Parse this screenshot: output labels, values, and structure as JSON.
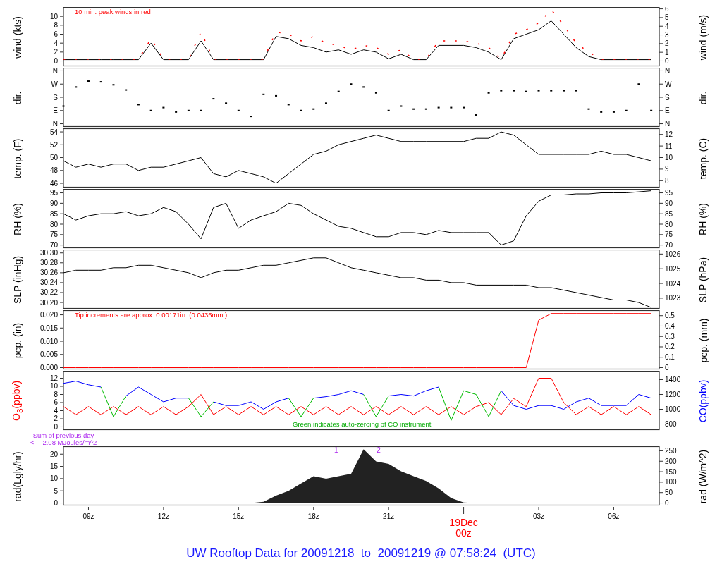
{
  "panels": [
    {
      "left_title": "wind (kts)",
      "right_title": "wind (m/s)",
      "note": "10 min. peak winds in red",
      "chart_data": {
        "type": "line",
        "categories": [
          null,
          null,
          null,
          null,
          null,
          null,
          null,
          null,
          null,
          null,
          null,
          null,
          null,
          null,
          null,
          null,
          null,
          null,
          null,
          null,
          null,
          null,
          null,
          null,
          null,
          null,
          null,
          null,
          null,
          null,
          null,
          null,
          null,
          null,
          null,
          null,
          null,
          null,
          null,
          null,
          null,
          null,
          null,
          null,
          null,
          null,
          null,
          null
        ],
        "ylim": [
          -1.1,
          12
        ],
        "yticks": [
          0,
          2,
          4,
          6,
          8,
          10
        ],
        "y2lim": [
          -0.57,
          6.17
        ],
        "y2ticks": [
          0,
          1,
          2,
          3,
          4,
          5,
          6
        ],
        "series": [
          {
            "color": "#000000",
            "values": [
              0.3,
              0.3,
              0.3,
              0.3,
              0.3,
              0.3,
              0.3,
              4,
              0.3,
              0.3,
              0.3,
              4.5,
              0.3,
              0.3,
              0.3,
              0.3,
              0.3,
              5.5,
              5,
              3.5,
              3,
              2,
              2.5,
              1.5,
              2.5,
              2,
              0.5,
              1.5,
              0.3,
              0.3,
              3.5,
              3.5,
              3.5,
              3,
              2,
              0.3,
              5,
              6,
              7,
              9,
              6,
              3,
              1,
              0.3,
              0.3,
              0.3,
              0.3,
              0.3
            ]
          },
          {
            "color": "#ff0000",
            "line_style": "dashed",
            "values": [
              0.4,
              0.4,
              0.4,
              0.4,
              0.4,
              0.4,
              0.4,
              5,
              0.4,
              0.4,
              0.4,
              6.5,
              0.4,
              0.4,
              0.4,
              0.4,
              0.4,
              6.5,
              6,
              4.5,
              5.5,
              4,
              3.5,
              2.5,
              3.5,
              3,
              1.5,
              2.5,
              0.4,
              0.4,
              4.5,
              4.5,
              4.5,
              4,
              3,
              0.4,
              6,
              7,
              8.5,
              11.5,
              8,
              4,
              2,
              0.4,
              0.4,
              0.4,
              0.4,
              0.4
            ]
          }
        ]
      }
    },
    {
      "left_title": "dir.",
      "right_title": "dir.",
      "direction_scale": {
        "left": [
          "N",
          "W",
          "S",
          "E",
          "N"
        ],
        "right": [
          "N",
          "W",
          "S",
          "E",
          "N"
        ]
      }
    },
    {
      "left_title": "temp. (F)",
      "right_title": "temp. (C)",
      "chart_data": {
        "type": "line",
        "categories": [
          null,
          null,
          null,
          null,
          null,
          null,
          null,
          null,
          null,
          null,
          null,
          null,
          null,
          null,
          null,
          null,
          null,
          null,
          null,
          null,
          null,
          null,
          null,
          null,
          null,
          null,
          null,
          null,
          null,
          null,
          null,
          null,
          null,
          null,
          null,
          null,
          null,
          null,
          null,
          null,
          null,
          null,
          null,
          null,
          null,
          null,
          null,
          null
        ],
        "ylim": [
          45.4,
          54.5
        ],
        "yticks": [
          46,
          48,
          50,
          52,
          54
        ],
        "y2lim": [
          7.44,
          12.5
        ],
        "y2ticks": [
          8,
          9,
          10,
          11,
          12
        ],
        "series": [
          {
            "color": "#000000",
            "values": [
              49.5,
              48.5,
              49,
              48.5,
              49,
              49,
              48,
              48.5,
              48.5,
              49,
              49.5,
              50,
              47.5,
              47,
              48,
              47.5,
              47,
              46,
              47.5,
              49,
              50.5,
              51,
              52,
              52.5,
              53,
              53.5,
              53,
              52.5,
              52.5,
              52.5,
              52.5,
              52.5,
              52.5,
              53,
              53,
              54,
              53.5,
              52,
              50.5,
              50.5,
              50.5,
              50.5,
              50.5,
              51,
              50.5,
              50.5,
              50,
              49.5
            ]
          }
        ]
      }
    },
    {
      "left_title": "RH (%)",
      "right_title": "RH (%)",
      "chart_data": {
        "type": "line",
        "categories": [
          null,
          null,
          null,
          null,
          null,
          null,
          null,
          null,
          null,
          null,
          null,
          null,
          null,
          null,
          null,
          null,
          null,
          null,
          null,
          null,
          null,
          null,
          null,
          null,
          null,
          null,
          null,
          null,
          null,
          null,
          null,
          null,
          null,
          null,
          null,
          null,
          null,
          null,
          null,
          null,
          null,
          null,
          null,
          null,
          null,
          null,
          null,
          null
        ],
        "ylim": [
          68.7,
          96.7
        ],
        "yticks": [
          70,
          75,
          80,
          85,
          90,
          95
        ],
        "y2lim": [
          68.7,
          96.7
        ],
        "y2ticks": [
          70,
          75,
          80,
          85,
          90,
          95
        ],
        "series": [
          {
            "color": "#000000",
            "values": [
              85,
              82,
              84,
              85,
              85,
              86,
              84,
              85,
              88,
              86,
              80,
              73,
              88,
              90,
              78,
              82,
              84,
              86,
              90,
              89,
              85,
              82,
              79,
              78,
              76,
              74,
              74,
              76,
              76,
              75,
              77,
              76,
              76,
              76,
              76,
              70,
              72,
              84,
              91,
              94,
              94,
              94.5,
              94.5,
              95,
              95,
              95,
              95.5,
              96
            ]
          }
        ]
      }
    },
    {
      "left_title": "SLP (inHg)",
      "right_title": "SLP (hPa)",
      "chart_data": {
        "type": "line",
        "categories": [
          null,
          null,
          null,
          null,
          null,
          null,
          null,
          null,
          null,
          null,
          null,
          null,
          null,
          null,
          null,
          null,
          null,
          null,
          null,
          null,
          null,
          null,
          null,
          null,
          null,
          null,
          null,
          null,
          null,
          null,
          null,
          null,
          null,
          null,
          null,
          null,
          null,
          null,
          null,
          null,
          null,
          null,
          null,
          null,
          null,
          null,
          null,
          null
        ],
        "ylim": [
          30.188,
          30.306
        ],
        "yticks": [
          {
            "value": 30.2,
            "label": "30.20"
          },
          {
            "value": 30.22,
            "label": "30.22"
          },
          {
            "value": 30.24,
            "label": "30.24"
          },
          {
            "value": 30.26,
            "label": "30.26"
          },
          {
            "value": 30.28,
            "label": "30.28"
          },
          {
            "value": 30.3,
            "label": "30.30"
          }
        ],
        "y2lim": [
          1022.3,
          1026.28
        ],
        "y2ticks": [
          1023,
          1024,
          1025,
          1026
        ],
        "series": [
          {
            "color": "#000000",
            "values": [
              30.26,
              30.265,
              30.265,
              30.265,
              30.27,
              30.27,
              30.275,
              30.275,
              30.27,
              30.265,
              30.26,
              30.25,
              30.26,
              30.265,
              30.265,
              30.27,
              30.275,
              30.275,
              30.28,
              30.285,
              30.29,
              30.29,
              30.28,
              30.27,
              30.265,
              30.26,
              30.255,
              30.25,
              30.25,
              30.245,
              30.245,
              30.24,
              30.24,
              30.235,
              30.235,
              30.235,
              30.235,
              30.235,
              30.23,
              30.23,
              30.225,
              30.22,
              30.215,
              30.21,
              30.205,
              30.205,
              30.2,
              30.19
            ]
          }
        ]
      }
    },
    {
      "left_title": "pcp. (in)",
      "right_title": "pcp. (mm)",
      "note": "Tip increments are approx. 0.00171in. (0.0435mm.)",
      "chart_data": {
        "type": "line",
        "categories": [
          null,
          null,
          null,
          null,
          null,
          null,
          null,
          null,
          null,
          null,
          null,
          null,
          null,
          null,
          null,
          null,
          null,
          null,
          null,
          null,
          null,
          null,
          null,
          null,
          null,
          null,
          null,
          null,
          null,
          null,
          null,
          null,
          null,
          null,
          null,
          null,
          null,
          null,
          null,
          null,
          null,
          null,
          null,
          null,
          null,
          null,
          null,
          null
        ],
        "ylim": [
          -0.00054,
          0.02162
        ],
        "yticks": [
          {
            "value": 0,
            "label": "0.000"
          },
          {
            "value": 0.005,
            "label": "0.005"
          },
          {
            "value": 0.01,
            "label": "0.010"
          },
          {
            "value": 0.015,
            "label": "0.015"
          },
          {
            "value": 0.02,
            "label": "0.020"
          }
        ],
        "y2lim": [
          -0.0137,
          0.549
        ],
        "y2ticks": [
          0,
          0.1,
          0.2,
          0.3,
          0.4,
          0.5
        ],
        "series": [
          {
            "color": "#ff0000",
            "values": [
              0,
              0,
              0,
              0,
              0,
              0,
              0,
              0,
              0,
              0,
              0,
              0,
              0,
              0,
              0,
              0,
              0,
              0,
              0,
              0,
              0,
              0,
              0,
              0,
              0,
              0,
              0,
              0,
              0,
              0,
              0,
              0,
              0,
              0,
              0,
              0,
              0,
              0,
              0.018,
              0.0205,
              0.0205,
              0.0205,
              0.0205,
              0.0205,
              0.0205,
              0.0205,
              0.0205,
              0.0205
            ]
          }
        ]
      }
    },
    {
      "left_title": "O$_{3}$(ppbv)",
      "right_title": "CO(ppbv)",
      "footnote": "Green indicates auto-zeroing of CO instrument",
      "chart_data": {
        "type": "line",
        "categories": [
          null,
          null,
          null,
          null,
          null,
          null,
          null,
          null,
          null,
          null,
          null,
          null,
          null,
          null,
          null,
          null,
          null,
          null,
          null,
          null,
          null,
          null,
          null,
          null,
          null,
          null,
          null,
          null,
          null,
          null,
          null,
          null,
          null,
          null,
          null,
          null,
          null,
          null,
          null,
          null,
          null,
          null,
          null,
          null,
          null,
          null,
          null,
          null
        ],
        "ylim": [
          -0.7,
          13.74
        ],
        "yticks": [
          0,
          2,
          4,
          6,
          8,
          10,
          12
        ],
        "y2lim": [
          724,
          1514
        ],
        "y2ticks": [
          800,
          1000,
          1200,
          1400
        ],
        "series": [
          {
            "color": "#ff0000",
            "values": [
              5,
              3,
              5,
              3,
              5,
              3,
              5,
              3,
              5,
              3,
              5,
              8,
              3,
              5,
              3,
              5,
              3,
              5,
              3,
              5,
              3,
              5,
              3,
              5,
              3,
              5,
              3,
              5,
              3,
              5,
              3,
              5,
              3,
              5,
              6,
              3,
              7,
              5,
              12,
              12,
              6,
              3,
              5,
              3,
              5,
              3,
              5,
              3
            ]
          },
          {
            "axis": "y2",
            "color": "#0000ff",
            "values": [
              1350,
              1380,
              1330,
              1300,
              null,
              1180,
              1300,
              1200,
              1100,
              1150,
              1150,
              null,
              1100,
              1050,
              1050,
              1100,
              1000,
              1100,
              1150,
              null,
              1150,
              1170,
              1200,
              1250,
              1200,
              null,
              1180,
              1200,
              1180,
              1250,
              1300,
              null,
              null,
              null,
              null,
              1250,
              1050,
              1000,
              1050,
              1050,
              1000,
              1100,
              1150,
              1050,
              1050,
              1050,
              1200,
              1150
            ]
          },
          {
            "axis": "y2",
            "color": "#00bb00",
            "values": [
              null,
              null,
              null,
              1300,
              900,
              1180,
              null,
              null,
              null,
              null,
              1150,
              900,
              1100,
              null,
              null,
              null,
              null,
              null,
              1150,
              900,
              1150,
              null,
              null,
              null,
              1200,
              900,
              1180,
              null,
              null,
              null,
              1300,
              850,
              1250,
              1200,
              900,
              1250,
              null,
              null,
              null,
              null,
              null,
              null,
              null,
              null,
              null,
              null,
              null,
              null
            ]
          }
        ]
      }
    },
    {
      "left_title": "rad(Lgly/hr)",
      "right_title": "rad (W/m^2)",
      "margin_notes": [
        "Sum of previous day",
        "<--- 2.08 MJoules/m^2"
      ],
      "markers": [
        "1",
        "2"
      ],
      "chart_data": {
        "type": "area",
        "categories": [
          null,
          null,
          null,
          null,
          null,
          null,
          null,
          null,
          null,
          null,
          null,
          null,
          null,
          null,
          null,
          null,
          null,
          null,
          null,
          null,
          null,
          null,
          null,
          null,
          null,
          null,
          null,
          null,
          null,
          null,
          null,
          null,
          null,
          null,
          null,
          null,
          null,
          null,
          null,
          null,
          null,
          null,
          null,
          null,
          null,
          null,
          null,
          null
        ],
        "ylim": [
          -0.86,
          23.1
        ],
        "yticks": [
          0,
          5,
          10,
          15,
          20
        ],
        "y2lim": [
          -10,
          270
        ],
        "y2ticks": [
          0,
          50,
          100,
          150,
          200,
          250
        ],
        "series": [
          {
            "color": "#222222",
            "values": [
              0,
              0,
              0,
              0,
              0,
              0,
              0,
              0,
              0,
              0,
              0,
              0,
              0,
              0,
              0,
              0,
              0.5,
              3,
              5,
              8,
              11,
              10,
              11,
              12,
              22,
              17,
              16,
              13,
              11,
              9,
              6,
              2,
              0.2,
              0,
              0,
              0,
              0,
              0,
              0,
              0,
              0,
              0,
              0,
              0,
              0,
              0,
              0,
              0
            ]
          }
        ]
      }
    }
  ],
  "time_axis": {
    "ticks": [
      {
        "label": "09z",
        "day_start": false
      },
      {
        "label": "12z",
        "day_start": false
      },
      {
        "label": "15z",
        "day_start": false
      },
      {
        "label": "18z",
        "day_start": false
      },
      {
        "label": "21z",
        "day_start": false
      },
      {
        "label": "00z",
        "day_start": true
      },
      {
        "label": "03z",
        "day_start": false
      },
      {
        "label": "06z",
        "day_start": false
      }
    ],
    "day_label": "19Dec"
  },
  "title": "UW Rooftop Data for 20091218  to  20091219 @ 07:58:24  (UTC)"
}
